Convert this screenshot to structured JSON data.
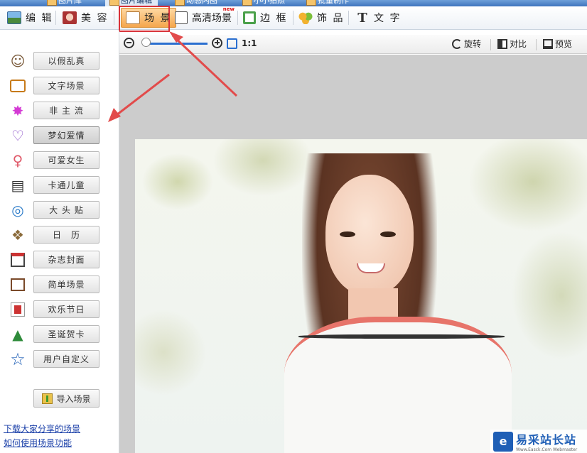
{
  "top_tabs": [
    "图片库",
    "图片编辑",
    "动感闪图",
    "小小拍照",
    "批量制作"
  ],
  "toolbar": {
    "items": [
      {
        "label": "编 辑",
        "icon": "landscape-icon"
      },
      {
        "label": "美 容",
        "icon": "face-icon"
      },
      {
        "label": "场 景",
        "icon": "scene-icon"
      },
      {
        "label": "高清场景",
        "icon": "hd-scene-icon",
        "badge": "new"
      },
      {
        "label": "边 框",
        "icon": "frame-icon"
      },
      {
        "label": "饰 品",
        "icon": "accessory-icon"
      },
      {
        "label": "文 字",
        "icon": "text-icon"
      }
    ]
  },
  "sidebar": {
    "categories": [
      {
        "label": "以假乱真",
        "icon": "mask-icon"
      },
      {
        "label": "文字场景",
        "icon": "text-scene-icon"
      },
      {
        "label": "非 主 流",
        "icon": "sparkle-icon"
      },
      {
        "label": "梦幻爱情",
        "icon": "heart-icon",
        "selected": true
      },
      {
        "label": "可爱女生",
        "icon": "female-icon"
      },
      {
        "label": "卡通儿童",
        "icon": "book-icon"
      },
      {
        "label": "大 头 贴",
        "icon": "avatar-icon"
      },
      {
        "label": "日　历",
        "icon": "calendar-dog-icon"
      },
      {
        "label": "杂志封面",
        "icon": "calendar-18-icon"
      },
      {
        "label": "简单场景",
        "icon": "easel-icon"
      },
      {
        "label": "欢乐节日",
        "icon": "spring-icon"
      },
      {
        "label": "圣诞贺卡",
        "icon": "tree-icon"
      },
      {
        "label": "用户自定义",
        "icon": "star-icon"
      }
    ],
    "import_label": "导入场景",
    "links": [
      "下载大家分享的场景",
      "如何使用场景功能"
    ]
  },
  "canvas_toolbar": {
    "ratio": "1:1",
    "rotate": "旋转",
    "compare": "对比",
    "preview": "预览",
    "zoom_level": 0.05
  },
  "watermark": {
    "title": "易采站长站",
    "subtitle": "Www.Easck.Com Webmaster"
  },
  "colors": {
    "highlight_red": "#d8333a",
    "selected_tool": "#f4a64d",
    "accent_blue": "#2b6fd0"
  }
}
